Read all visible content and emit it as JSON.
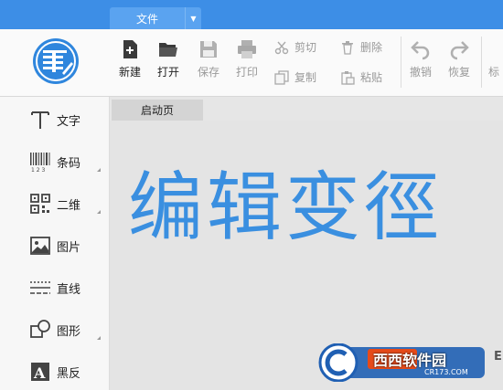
{
  "menu": {
    "file_label": "文件",
    "dropdown_icon": "triangle-down-icon"
  },
  "ribbon": {
    "new_label": "新建",
    "open_label": "打开",
    "save_label": "保存",
    "print_label": "打印",
    "cut_label": "剪切",
    "copy_label": "复制",
    "delete_label": "删除",
    "paste_label": "粘贴",
    "undo_label": "撤销",
    "redo_label": "恢复",
    "more_label": "标"
  },
  "sidebar": {
    "items": [
      {
        "label": "文字",
        "icon": "text-icon"
      },
      {
        "label": "条码",
        "icon": "barcode-icon"
      },
      {
        "label": "二维",
        "icon": "qrcode-icon"
      },
      {
        "label": "图片",
        "icon": "image-icon"
      },
      {
        "label": "直线",
        "icon": "line-icon"
      },
      {
        "label": "图形",
        "icon": "shape-icon"
      },
      {
        "label": "黑反",
        "icon": "invert-icon"
      }
    ]
  },
  "document": {
    "tab_label": "启动页",
    "headline": "编辑变徑",
    "sub_letters": "El"
  },
  "watermark": {
    "main": "西西软件园",
    "sub": "CR173.COM"
  },
  "colors": {
    "accent": "#3d8ee6",
    "headline": "#3a8fe0"
  }
}
